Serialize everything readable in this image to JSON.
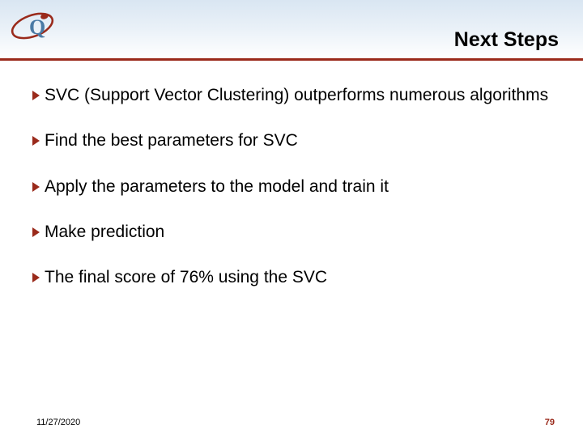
{
  "header": {
    "title": "Next Steps"
  },
  "bullets": [
    "SVC (Support Vector Clustering) outperforms numerous algorithms",
    "Find the best parameters for SVC",
    "Apply the parameters to the model and train it",
    "Make prediction",
    "The final score of 76% using the SVC"
  ],
  "footer": {
    "date": "11/27/2020",
    "page": "79"
  }
}
